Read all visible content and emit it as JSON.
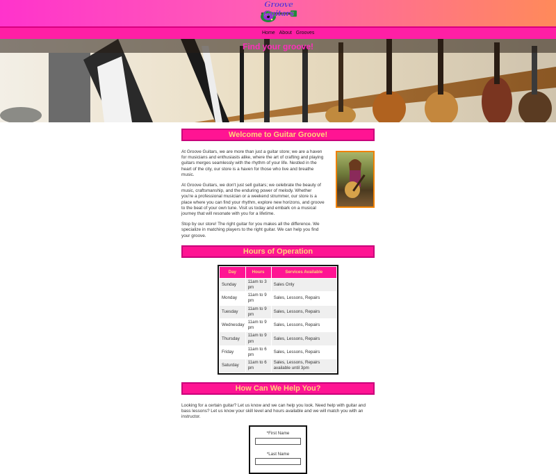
{
  "site": {
    "logo_text": "Groove Guitars"
  },
  "nav": {
    "items": [
      "Home",
      "About",
      "Grooves"
    ]
  },
  "hero": {
    "title": "Find your groove!"
  },
  "welcome": {
    "heading": "Welcome to Guitar Groove!",
    "paragraphs": [
      "At Groove Guitars, we are more than just a guitar store; we are a haven for musicians and enthusiasts alike, where the art of crafting and playing guitars merges seamlessly with the rhythm of your life. Nestled in the heart of the city, our store is a haven for those who live and breathe music.",
      "At Groove Guitars, we don't just sell guitars; we celebrate the beauty of music, craftsmanship, and the enduring power of melody. Whether you're a professional musician or a weekend strummer, our store is a place where you can find your rhythm, explore new horizons, and groove to the beat of your own tune. Visit us today and embark on a musical journey that will resonate with you for a lifetime.",
      "Stop by our store! The right guitar for you makes all the difference. We specialize in matching players to the right guitar. We can help you find your groove."
    ]
  },
  "hours": {
    "heading": "Hours of Operation",
    "columns": [
      "Day",
      "Hours",
      "Services Available"
    ],
    "rows": [
      {
        "day": "Sunday",
        "hours": "11am to 3 pm",
        "services": "Sales Only"
      },
      {
        "day": "Monday",
        "hours": "11am to 9 pm",
        "services": "Sales, Lessons, Repairs"
      },
      {
        "day": "Tuesday",
        "hours": "11am to 9 pm",
        "services": "Sales, Lessons, Repairs"
      },
      {
        "day": "Wednesday",
        "hours": "11am to 9 pm",
        "services": "Sales, Lessons, Repairs"
      },
      {
        "day": "Thursday",
        "hours": "11am to 9 pm",
        "services": "Sales, Lessons, Repairs"
      },
      {
        "day": "Friday",
        "hours": "11am to 6 pm",
        "services": "Sales, Lessons, Repairs"
      },
      {
        "day": "Saturday",
        "hours": "11am to 6 pm",
        "services": "Sales, Lessons, Repairs available until 3pm"
      }
    ]
  },
  "help": {
    "heading": "How Can We Help You?",
    "text": "Looking for a certain guitar? Let us know and we can help you look. Need help with guitar and bass lessons? Let us know your skill level and hours available and we will match you with an instructor."
  },
  "form": {
    "first_name_label": "*First Name",
    "last_name_label": "*Last Name"
  },
  "colors": {
    "accent": "#ff1493",
    "heading_text": "#ffd37a",
    "header_gradient_start": "#ff33cc",
    "header_gradient_end": "#ff8a5a"
  }
}
